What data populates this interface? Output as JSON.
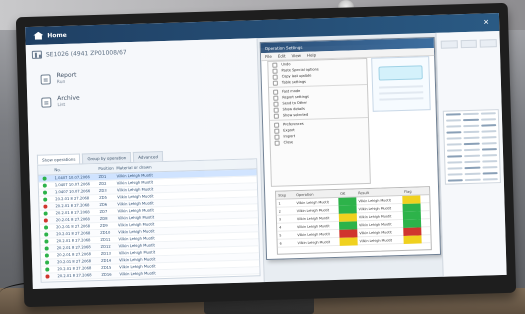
{
  "app": {
    "title": "Home",
    "company_line": "SE1026 (4941 ZP01008/67"
  },
  "nav": {
    "items": [
      {
        "label": "Report",
        "sub": "Run"
      },
      {
        "label": "Archive",
        "sub": "List"
      }
    ]
  },
  "tabs": [
    {
      "label": "Show operations"
    },
    {
      "label": "Group by operation"
    },
    {
      "label": "Advanced"
    }
  ],
  "table": {
    "headers": [
      "",
      "No.",
      "Position",
      "Material or drawn",
      ""
    ],
    "rows": [
      {
        "status": "green",
        "no": "1.0407 10.07.2066",
        "pos": "ZD1",
        "material": "Vilkin Lehigh Muotit",
        "selected": true
      },
      {
        "status": "green",
        "no": "1.0407 10.07.2066",
        "pos": "ZD2",
        "material": "Vilkin Lehigh Muotit"
      },
      {
        "status": "green",
        "no": "1.0407 10.07.2066",
        "pos": "ZD3",
        "material": "Vilkin Lehigh Muotit"
      },
      {
        "status": "green",
        "no": "20.2.01 8 27.2068",
        "pos": "ZD5",
        "material": "Vilkin Lehigh Muotit"
      },
      {
        "status": "red",
        "no": "20.2.01 8 27.2068",
        "pos": "ZD6",
        "material": "Vilkin Lehigh Muotit"
      },
      {
        "status": "green",
        "no": "20.2.01 8 27.2068",
        "pos": "ZD7",
        "material": "Vilkin Lehigh Muotit"
      },
      {
        "status": "red",
        "no": "20.2.01 8 27.2068",
        "pos": "ZD8",
        "material": "Vilkin Lehigh Muotit"
      },
      {
        "status": "green",
        "no": "20.2.01 8 27.2068",
        "pos": "ZD9",
        "material": "Vilkin Lehigh Muotit"
      },
      {
        "status": "green",
        "no": "20.2.01 8 27.2068",
        "pos": "ZD10",
        "material": "Vilkin Lehigh Muotit"
      },
      {
        "status": "green",
        "no": "20.2.01 8 27.2068",
        "pos": "ZD11",
        "material": "Vilkin Lehigh Muotit"
      },
      {
        "status": "green",
        "no": "20.2.01 8 27.2068",
        "pos": "ZD12",
        "material": "Vilkin Lehigh Muotit"
      },
      {
        "status": "green",
        "no": "20.2.01 8 27.2068",
        "pos": "ZD13",
        "material": "Vilkin Lehigh Muotit"
      },
      {
        "status": "green",
        "no": "20.2.01 8 27.2068",
        "pos": "ZD14",
        "material": "Vilkin Lehigh Muotit"
      },
      {
        "status": "green",
        "no": "20.2.01 8 27.2068",
        "pos": "ZD15",
        "material": "Vilkin Lehigh Muotit"
      },
      {
        "status": "red",
        "no": "20.2.01 8 27.2068",
        "pos": "ZD16",
        "material": "Vilkin Lehigh Muotit"
      }
    ]
  },
  "dialog": {
    "title": "Operation Settings",
    "menubar": [
      "File",
      "Edit",
      "View",
      "Help"
    ],
    "menu_items": [
      "Undo",
      "Paste Special options",
      "Copy last update",
      "Table settings",
      "Fast mode",
      "Report settings",
      "Send to Other",
      "Show details",
      "Show selected",
      "Preferences",
      "Export",
      "Import",
      "Close"
    ]
  },
  "status_grid": {
    "headers": [
      "Step",
      "Operation",
      "OK",
      "Result",
      "Flag"
    ],
    "rows": [
      {
        "step": "1",
        "op": "Vilkin Lehigh Muotit",
        "ok": "",
        "result": "Vilkin Lehigh Muotit",
        "flag": ""
      },
      {
        "step": "2",
        "op": "Vilkin Lehigh Muotit",
        "ok": "",
        "result": "Vilkin Lehigh Muotit",
        "flag": ""
      },
      {
        "step": "3",
        "op": "Vilkin Lehigh Muotit",
        "ok": "",
        "result": "Vilkin Lehigh Muotit",
        "flag": ""
      },
      {
        "step": "4",
        "op": "Vilkin Lehigh Muotit",
        "ok": "",
        "result": "Vilkin Lehigh Muotit",
        "flag": ""
      },
      {
        "step": "5",
        "op": "Vilkin Lehigh Muotit",
        "ok": "",
        "result": "Vilkin Lehigh Muotit",
        "flag": ""
      },
      {
        "step": "6",
        "op": "Vilkin Lehigh Muotit",
        "ok": "",
        "result": "Vilkin Lehigh Muotit",
        "flag": ""
      }
    ]
  },
  "colors": {
    "status_green": "#2db34a",
    "status_red": "#d0352e",
    "status_yellow": "#f0d11f"
  },
  "icons": {
    "home": "home-icon",
    "close": "close-icon",
    "company": "company-icon",
    "nav_report": "report-icon",
    "nav_archive": "archive-icon"
  }
}
